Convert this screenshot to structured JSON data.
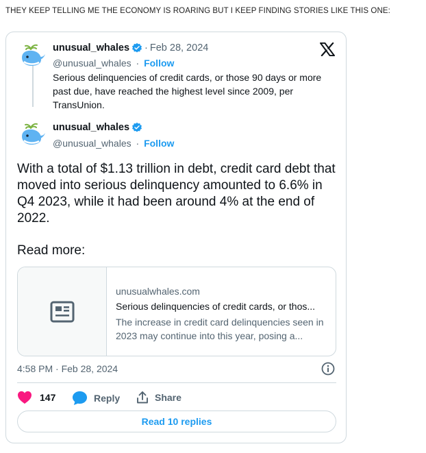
{
  "post": {
    "header_text": "THEY KEEP TELLING ME THE ECONOMY IS ROARING BUT I KEEP FINDING STORIES LIKE THIS ONE:"
  },
  "quoted_tweet": {
    "display_name": "unusual_whales",
    "date": "Feb 28, 2024",
    "handle": "@unusual_whales",
    "follow_label": "Follow",
    "text": "Serious delinquencies of credit cards, or those 90 days or more past due, have reached the highest level since 2009, per TransUnion."
  },
  "tweet": {
    "display_name": "unusual_whales",
    "handle": "@unusual_whales",
    "follow_label": "Follow",
    "text": "With a total of $1.13 trillion in debt, credit card debt that moved into serious delinquency amounted to 6.6% in Q4 2023, while it had been around 4% at the end of 2022.",
    "read_more": "Read more:",
    "link_card": {
      "domain": "unusualwhales.com",
      "title": "Serious delinquencies of credit cards, or thos...",
      "description": "The increase in credit card delinquencies seen in 2023 may continue into this year, posing a..."
    },
    "timestamp": "4:58 PM · Feb 28, 2024",
    "actions": {
      "likes": "147",
      "reply_label": "Reply",
      "share_label": "Share"
    },
    "replies_button": "Read 10 replies"
  },
  "colors": {
    "accent": "#1d9bf0",
    "like": "#f91880",
    "secondary_text": "#536471",
    "border": "#cfd9de"
  },
  "icons": [
    "whale-avatar-icon",
    "verified-badge-icon",
    "x-logo-icon",
    "article-icon",
    "info-icon",
    "heart-icon",
    "reply-bubble-icon",
    "share-icon"
  ]
}
